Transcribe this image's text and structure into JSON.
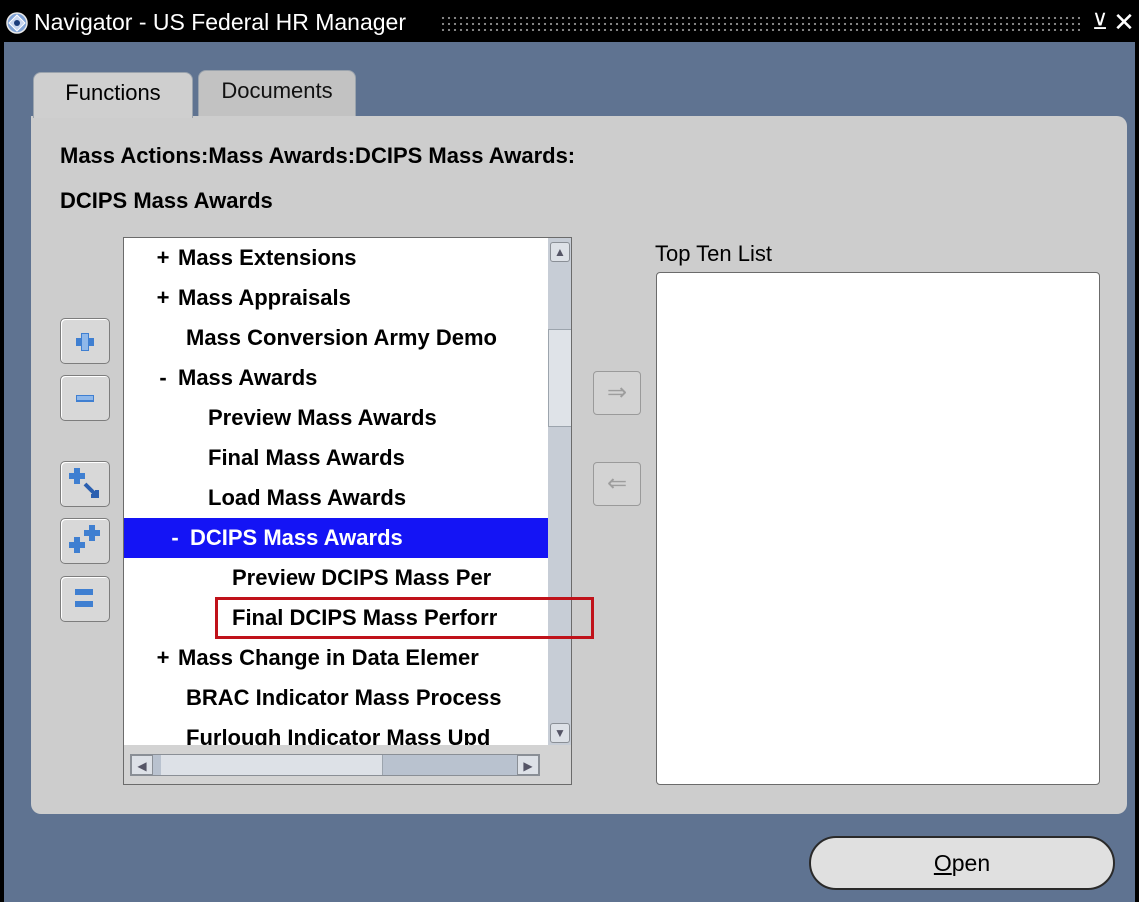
{
  "window": {
    "title": "Navigator - US Federal HR Manager",
    "minimize_glyph": "⊻",
    "close_glyph": "✕"
  },
  "tabs": [
    {
      "label": "Functions",
      "active": true
    },
    {
      "label": "Documents",
      "active": false
    }
  ],
  "breadcrumb": "Mass Actions:Mass Awards:DCIPS Mass Awards:",
  "page_title": "DCIPS Mass Awards",
  "side_buttons": [
    {
      "icon": "expand-plus-icon"
    },
    {
      "icon": "collapse-minus-icon"
    },
    {
      "icon": "expand-branch-icon"
    },
    {
      "icon": "expand-all-icon"
    },
    {
      "icon": "collapse-all-icon"
    }
  ],
  "tree": {
    "items": [
      {
        "toggle": "+",
        "label": "Mass Extensions",
        "selected": false
      },
      {
        "toggle": "+",
        "label": "Mass Appraisals",
        "selected": false
      },
      {
        "toggle": "",
        "label": "Mass Conversion Army Demo",
        "selected": false
      },
      {
        "toggle": "-",
        "label": "Mass Awards",
        "selected": false
      },
      {
        "toggle": "",
        "label": "Preview Mass Awards",
        "selected": false
      },
      {
        "toggle": "",
        "label": "Final Mass Awards",
        "selected": false
      },
      {
        "toggle": "",
        "label": "Load Mass Awards",
        "selected": false
      },
      {
        "toggle": "-",
        "label": "DCIPS Mass Awards",
        "selected": true
      },
      {
        "toggle": "",
        "label": "Preview DCIPS Mass Per",
        "selected": false
      },
      {
        "toggle": "",
        "label": "Final DCIPS Mass Perforr",
        "selected": false,
        "highlighted": true
      },
      {
        "toggle": "+",
        "label": "Mass Change in Data Elemer",
        "selected": false
      },
      {
        "toggle": "",
        "label": "BRAC Indicator Mass Process",
        "selected": false
      },
      {
        "toggle": "",
        "label": "Furlough Indicator Mass Upd",
        "selected": false
      }
    ]
  },
  "move_buttons": {
    "add": {
      "glyph": "⇒",
      "icon": "arrow-right-icon",
      "enabled": false
    },
    "remove": {
      "glyph": "⇐",
      "icon": "arrow-left-icon",
      "enabled": false
    }
  },
  "top_ten": {
    "label": "Top Ten List",
    "items": []
  },
  "open_button": {
    "mnemonic": "O",
    "rest": "pen"
  },
  "colors": {
    "background": "#5f7391",
    "panel": "#cdcdcd",
    "selection": "#1414f5",
    "highlight_border": "#c0121a"
  }
}
